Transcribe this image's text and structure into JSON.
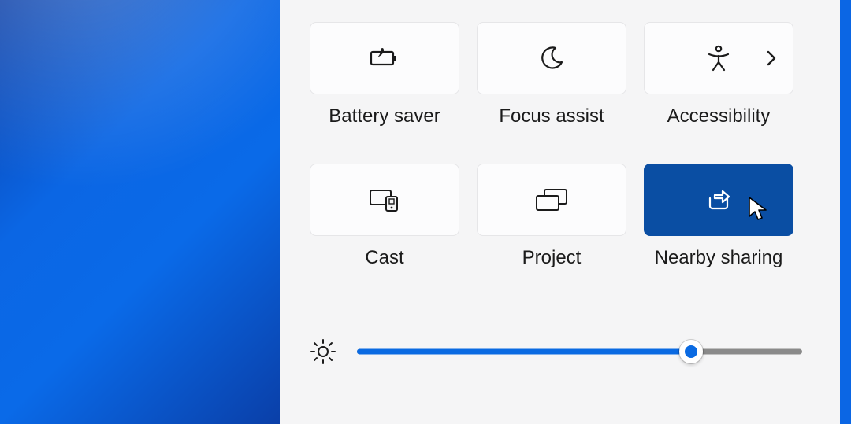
{
  "panel": {
    "tiles": [
      {
        "id": "battery-saver",
        "label": "Battery saver",
        "icon": "battery-saver-icon",
        "active": false,
        "has_submenu": false
      },
      {
        "id": "focus-assist",
        "label": "Focus assist",
        "icon": "moon-icon",
        "active": false,
        "has_submenu": false
      },
      {
        "id": "accessibility",
        "label": "Accessibility",
        "icon": "accessibility-icon",
        "active": false,
        "has_submenu": true
      },
      {
        "id": "cast",
        "label": "Cast",
        "icon": "cast-icon",
        "active": false,
        "has_submenu": false
      },
      {
        "id": "project",
        "label": "Project",
        "icon": "project-icon",
        "active": false,
        "has_submenu": false
      },
      {
        "id": "nearby-sharing",
        "label": "Nearby sharing",
        "icon": "share-icon",
        "active": true,
        "has_submenu": false
      }
    ],
    "brightness": {
      "value_percent": 75
    }
  },
  "colors": {
    "accent": "#0a6ae2",
    "tile_active": "#0a4ea3",
    "panel_bg": "#f5f5f6"
  }
}
